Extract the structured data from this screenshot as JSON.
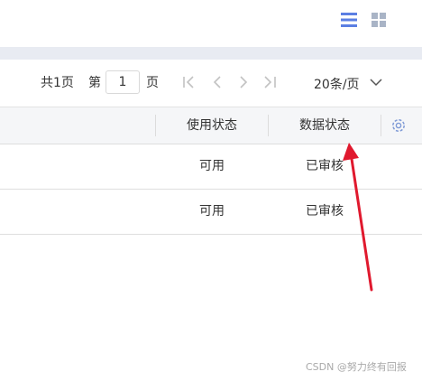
{
  "pager": {
    "total_pages": "共1页",
    "page_prefix": "第",
    "current_page": "1",
    "page_suffix": "页",
    "page_size": "20条/页"
  },
  "table": {
    "columns": [
      "使用状态",
      "数据状态"
    ],
    "rows": [
      [
        "可用",
        "已审核"
      ],
      [
        "可用",
        "已审核"
      ]
    ]
  },
  "icons": {
    "list_view": "list-view-icon",
    "grid_view": "grid-view-icon",
    "settings": "gear-icon",
    "annotation": "red-arrow"
  },
  "colors": {
    "accent": "#5b7fe3",
    "arrow": "#e0192e",
    "header_bg": "#f5f6f8",
    "band": "#e8ebf2"
  },
  "watermark": "CSDN @努力终有回报"
}
